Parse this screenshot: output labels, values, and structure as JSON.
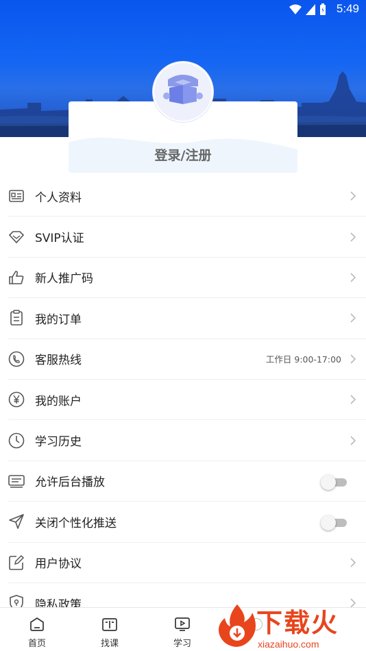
{
  "status_bar": {
    "time": "5:49"
  },
  "profile": {
    "login_label": "登录/注册"
  },
  "menu": [
    {
      "label": "个人资料",
      "icon": "id-card-icon"
    },
    {
      "label": "SVIP认证",
      "icon": "diamond-icon"
    },
    {
      "label": "新人推广码",
      "icon": "thumbs-up-icon"
    },
    {
      "label": "我的订单",
      "icon": "clipboard-icon"
    },
    {
      "label": "客服热线",
      "icon": "phone-icon",
      "note": "工作日 9:00-17:00"
    },
    {
      "label": "我的账户",
      "icon": "yen-icon"
    },
    {
      "label": "学习历史",
      "icon": "clock-icon"
    },
    {
      "label": "允许后台播放",
      "icon": "keyboard-icon",
      "toggle": false
    },
    {
      "label": "关闭个性化推送",
      "icon": "send-icon",
      "toggle": false
    },
    {
      "label": "用户协议",
      "icon": "edit-icon"
    },
    {
      "label": "隐私政策",
      "icon": "shield-icon"
    }
  ],
  "bottom_nav": [
    {
      "label": "首页",
      "icon": "home-icon"
    },
    {
      "label": "找课",
      "icon": "book-icon"
    },
    {
      "label": "学习",
      "icon": "play-icon"
    }
  ],
  "watermark": {
    "title": "下载火",
    "subtitle": "xiazaihuo.com"
  },
  "colors": {
    "header_blue": "#0a56ee",
    "brand_orange": "#e8451d"
  }
}
